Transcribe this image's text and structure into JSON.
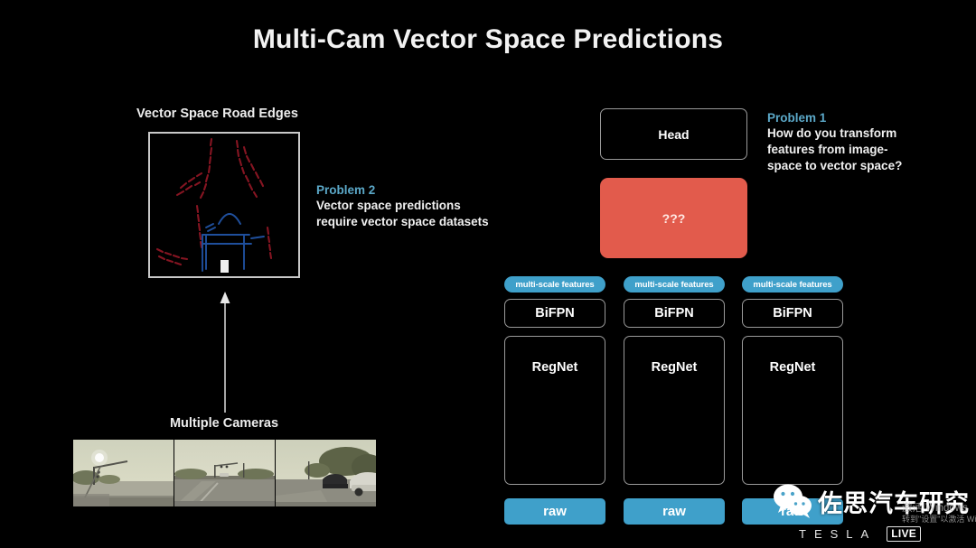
{
  "slide": {
    "title": "Multi-Cam Vector Space Predictions",
    "background_color": "#000000"
  },
  "colors": {
    "accent_blue": "#3FA0CA",
    "problem_heading_blue": "#5BA8C8",
    "highlight_salmon": "#E25B4C",
    "box_border_gray": "#9A9A9A",
    "text_white": "#FFFFFF"
  },
  "left_panel": {
    "vector_space_label": "Vector Space Road Edges",
    "cameras_label": "Multiple Cameras",
    "camera_views": [
      {
        "name": "left-pillar-camera"
      },
      {
        "name": "forward-main-camera"
      },
      {
        "name": "right-pillar-camera"
      }
    ],
    "arrow": {
      "direction": "up",
      "name": "upward-flow-arrow"
    }
  },
  "problems": [
    {
      "id": "problem2",
      "heading": "Problem 2",
      "body": "Vector space predictions\nrequire vector space datasets"
    },
    {
      "id": "problem1",
      "heading": "Problem 1",
      "body": "How do you transform\nfeatures from image-\nspace to vector space?"
    }
  ],
  "network": {
    "head_label": "Head",
    "unknown_block_label": "???",
    "columns": [
      {
        "multi_scale_label": "multi-scale features",
        "bifpn_label": "BiFPN",
        "regnet_label": "RegNet",
        "raw_label": "raw"
      },
      {
        "multi_scale_label": "multi-scale features",
        "bifpn_label": "BiFPN",
        "regnet_label": "RegNet",
        "raw_label": "raw"
      },
      {
        "multi_scale_label": "multi-scale features",
        "bifpn_label": "BiFPN",
        "regnet_label": "RegNet",
        "raw_label": "raw"
      }
    ]
  },
  "watermarks": {
    "wechat_account": "佐思汽车研究",
    "windows_activation_line1": "激活 Windows",
    "windows_activation_line2": "转到\"设置\"以激活 Windows。",
    "tesla_wordmark": "TESLA",
    "live_badge": "LIVE"
  }
}
